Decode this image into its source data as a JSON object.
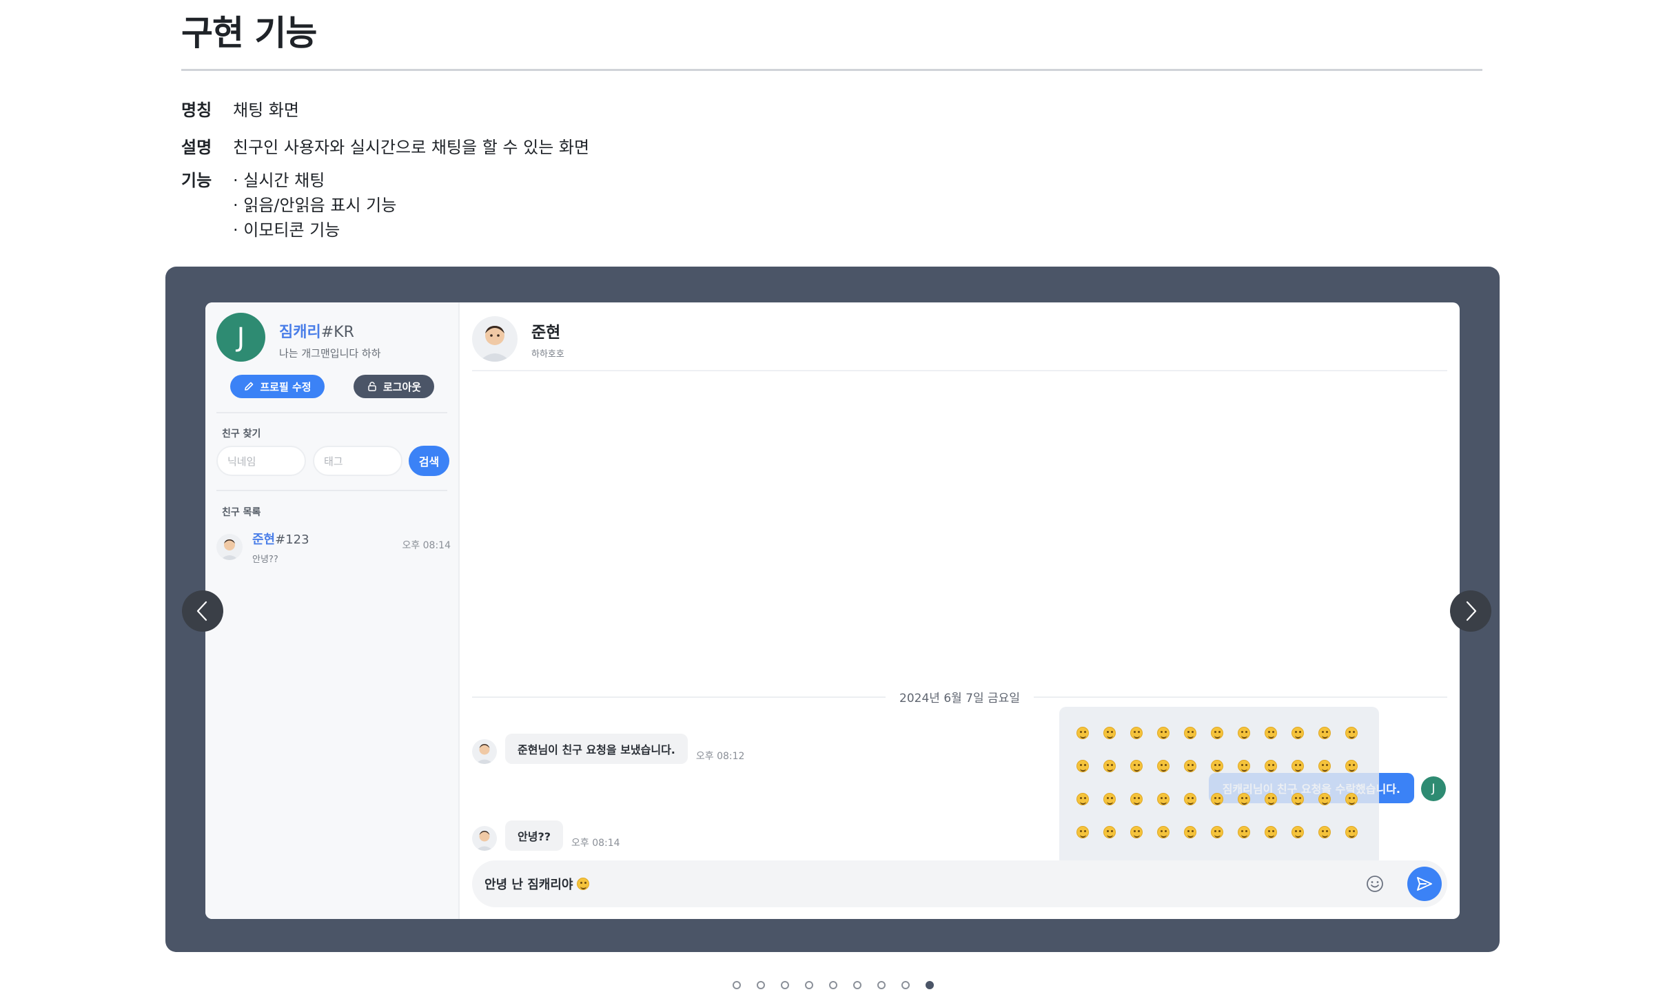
{
  "page": {
    "title": "구현 기능",
    "info": {
      "name_label": "명칭",
      "name_value": "채팅 화면",
      "desc_label": "설명",
      "desc_value": "친구인 사용자와 실시간으로 채팅을 할 수 있는 화면",
      "feature_label": "기능",
      "features": [
        "· 실시간 채팅",
        "· 읽음/안읽음 표시 기능",
        "· 이모티콘 기능"
      ]
    }
  },
  "app": {
    "profile": {
      "avatar_letter": "J",
      "nickname": "짐캐리",
      "tag": "#KR",
      "status": "나는 개그맨입니다 하하",
      "edit_label": "프로필 수정",
      "logout_label": "로그아웃"
    },
    "friend_search": {
      "section_label": "친구 찾기",
      "nickname_placeholder": "닉네임",
      "tag_placeholder": "태그",
      "search_label": "검색"
    },
    "friend_list": {
      "section_label": "친구 목록",
      "items": [
        {
          "nickname": "준현",
          "tag": "#123",
          "last_message": "안녕??",
          "time": "오후 08:14"
        }
      ]
    },
    "chat": {
      "partner_name": "준현",
      "partner_status": "하하호호",
      "date_separator": "2024년 6월 7일 금요일",
      "messages": [
        {
          "text": "준현님이 친구 요청을 보냈습니다.",
          "time": "오후 08:12"
        },
        {
          "text": "안녕??",
          "time": "오후 08:14"
        }
      ],
      "outgoing_message": "짐캐리님이 친구 요청을 수락했습니다.",
      "outgoing_avatar_letter": "J",
      "composer_text": "안녕 난 짐캐리야"
    }
  },
  "carousel": {
    "total_pages": 9,
    "active_page": 9
  },
  "colors": {
    "accent": "#3b82f6",
    "frame": "#4b5567",
    "avatar_green": "#2e8b72"
  }
}
